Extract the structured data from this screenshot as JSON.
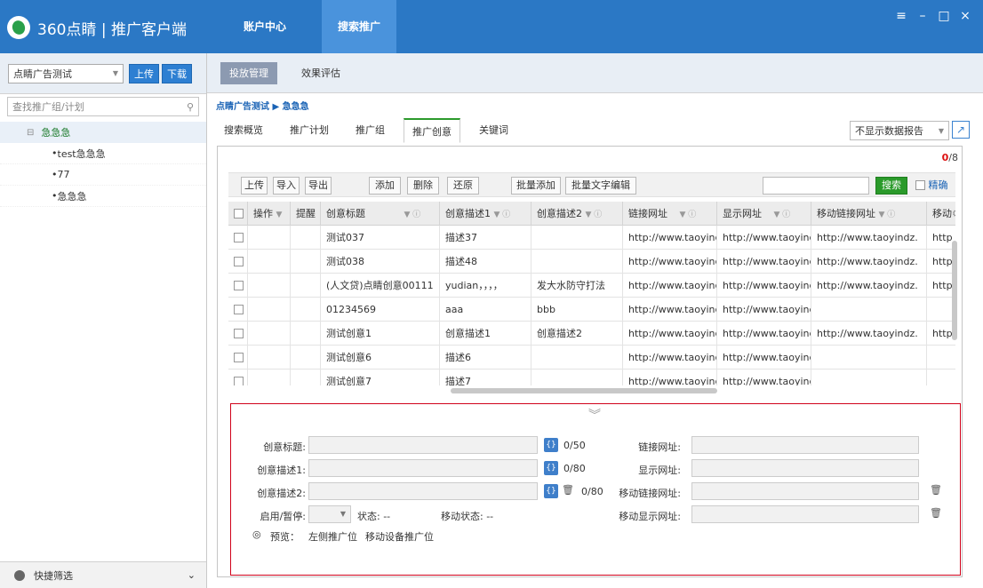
{
  "app": {
    "logo_text": "360点睛 | 推广客户端",
    "tabs": [
      "账户中心",
      "搜索推广"
    ],
    "active_tab": "搜索推广",
    "window_controls": [
      "≡",
      "–",
      "□",
      "×"
    ]
  },
  "sidebar": {
    "account": "点睛广告测试",
    "upload": "上传",
    "download": "下载",
    "search_placeholder": "查找推广组/计划",
    "tree_root": "急急急",
    "tree_items": [
      "test急急急",
      "77",
      "急急急"
    ],
    "quick_filter": "快捷筛选"
  },
  "subnav": {
    "tabs": [
      "投放管理",
      "效果评估"
    ],
    "active": "投放管理"
  },
  "breadcrumb": "点睛广告测试 ▶ 急急急",
  "main_tabs": [
    "搜索概览",
    "推广计划",
    "推广组",
    "推广创意",
    "关键词"
  ],
  "active_main_tab": "推广创意",
  "report_select": "不显示数据报告",
  "record_count": {
    "selected": "0",
    "total": "/8"
  },
  "toolbar": {
    "upload": "上传",
    "import": "导入",
    "export": "导出",
    "add": "添加",
    "delete": "删除",
    "restore": "还原",
    "batch_add": "批量添加",
    "batch_edit": "批量文字编辑",
    "search": "搜索",
    "precise": "精确"
  },
  "table": {
    "headers": [
      "操作",
      "提醒",
      "创意标题",
      "创意描述1",
      "创意描述2",
      "链接网址",
      "显示网址",
      "移动链接网址",
      "移动"
    ],
    "rows": [
      [
        "测试037",
        "描述37",
        "",
        "http://www.taoyinc",
        "http://www.taoyinc",
        "http://www.taoyindz.",
        "http"
      ],
      [
        "测试038",
        "描述48",
        "",
        "http://www.taoyinc",
        "http://www.taoyinc",
        "http://www.taoyindz.",
        "http"
      ],
      [
        "(人文贷)点睛创意00111",
        "yudian，，，，",
        "发大水防守打法",
        "http://www.taoyinc",
        "http://www.taoyinc",
        "http://www.taoyindz.",
        "http"
      ],
      [
        "01234569",
        "aaa",
        "bbb",
        "http://www.taoyinc",
        "http://www.taoyinc",
        "",
        ""
      ],
      [
        "测试创意1",
        "创意描述1",
        "创意描述2",
        "http://www.taoyinc",
        "http://www.taoyinc",
        "http://www.taoyindz.",
        "http"
      ],
      [
        "测试创意6",
        "描述6",
        "",
        "http://www.taoyinc",
        "http://www.taoyinc",
        "",
        ""
      ],
      [
        "测试创意7",
        "描述7",
        "",
        "http://www.taoyinc",
        "http://www.taoyinc",
        "",
        ""
      ]
    ]
  },
  "editor": {
    "title_label": "创意标题:",
    "desc1_label": "创意描述1:",
    "desc2_label": "创意描述2:",
    "enable_label": "启用/暂停:",
    "status": "状态: --",
    "mobile_status": "移动状态: --",
    "preview_label": "预览：",
    "preview_left": "左侧推广位",
    "preview_mobile": "移动设备推广位",
    "link_label": "链接网址:",
    "display_label": "显示网址:",
    "mobile_link_label": "移动链接网址:",
    "mobile_display_label": "移动显示网址:",
    "title_count": "0/50",
    "desc1_count": "0/80",
    "desc2_count": "0/80",
    "var_icon": "{}",
    "collapse_icon": "︾"
  },
  "colors": {
    "title_bar": "#2b78c5",
    "accent_green": "#2a9a2a",
    "editor_border": "#d0021b"
  }
}
